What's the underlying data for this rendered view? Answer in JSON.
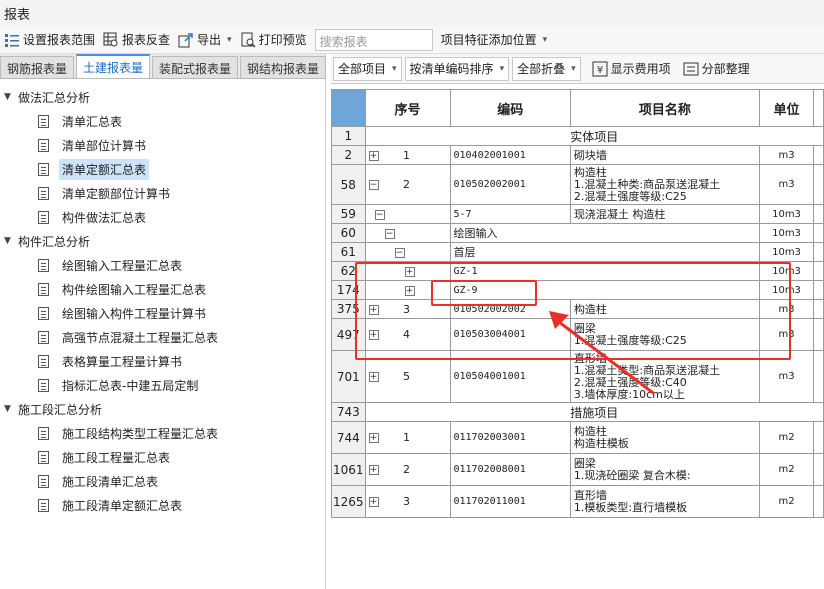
{
  "window": {
    "title": "报表"
  },
  "toolbar": {
    "set_range": "设置报表范围",
    "check": "报表反查",
    "export": "导出",
    "print_preview": "打印预览",
    "search_placeholder": "搜索报表",
    "feature_position": "项目特征添加位置"
  },
  "tabs": [
    "钢筋报表量",
    "土建报表量",
    "装配式报表量",
    "钢结构报表量"
  ],
  "tree": {
    "groups": [
      {
        "label": "做法汇总分析",
        "items": [
          "清单汇总表",
          "清单部位计算书",
          "清单定额汇总表",
          "清单定额部位计算书",
          "构件做法汇总表"
        ]
      },
      {
        "label": "构件汇总分析",
        "items": [
          "绘图输入工程量汇总表",
          "构件绘图输入工程量汇总表",
          "绘图输入构件工程量计算书",
          "高强节点混凝土工程量汇总表",
          "表格算量工程量计算书",
          "指标汇总表-中建五局定制"
        ]
      },
      {
        "label": "施工段汇总分析",
        "items": [
          "施工段结构类型工程量汇总表",
          "施工段工程量汇总表",
          "施工段清单汇总表",
          "施工段清单定额汇总表"
        ]
      }
    ],
    "selected": "清单定额汇总表"
  },
  "right_toolbar": {
    "all_items": "全部项目",
    "sort": "按清单编码排序",
    "collapse": "全部折叠",
    "show_fee": "显示费用项",
    "partition": "分部整理"
  },
  "table": {
    "headers": {
      "seq": "序号",
      "code": "编码",
      "name": "项目名称",
      "unit": "单位"
    },
    "section1": "实体项目",
    "section2": "措施项目",
    "rows": [
      {
        "rn": "1"
      },
      {
        "rn": "2",
        "seq": "1",
        "code": "010402001001",
        "name": "砌块墙",
        "unit": "m3"
      },
      {
        "rn": "58",
        "seq": "2",
        "code": "010502002001",
        "name": "构造柱\n1.混凝土种类:商品泵送混凝土\n2.混凝土强度等级:C25",
        "unit": "m3"
      },
      {
        "rn": "59",
        "code": "5-7",
        "name": "现浇混凝土 构造柱",
        "unit": "10m3"
      },
      {
        "rn": "60",
        "code": "绘图输入",
        "unit": "10m3"
      },
      {
        "rn": "61",
        "code": "首层",
        "unit": "10m3"
      },
      {
        "rn": "62",
        "code": "GZ-1",
        "unit": "10m3"
      },
      {
        "rn": "174",
        "code": "GZ-9",
        "unit": "10m3"
      },
      {
        "rn": "375",
        "seq": "3",
        "code": "010502002002",
        "name": "构造柱",
        "unit": "m3"
      },
      {
        "rn": "497",
        "seq": "4",
        "code": "010503004001",
        "name": "圈梁\n1.混凝土强度等级:C25",
        "unit": "m3"
      },
      {
        "rn": "701",
        "seq": "5",
        "code": "010504001001",
        "name": "直形墙\n1.混凝土类型:商品泵送混凝土\n2.混凝土强度等级:C40\n3.墙体厚度:10cm以上",
        "unit": "m3"
      },
      {
        "rn": "743"
      },
      {
        "rn": "744",
        "seq": "1",
        "code": "011702003001",
        "name": "构造柱\n构造柱模板",
        "unit": "m2"
      },
      {
        "rn": "1061",
        "seq": "2",
        "code": "011702008001",
        "name": "圈梁\n1.现浇砼圈梁 复合木模:",
        "unit": "m2"
      },
      {
        "rn": "1265",
        "seq": "3",
        "code": "011702011001",
        "name": "直形墙\n1.模板类型:直行墙模板",
        "unit": "m2"
      }
    ]
  },
  "colors": {
    "annotation": "#e8302a",
    "selected": "#cde3f7",
    "active_tab": "#1a6fc2",
    "header_corner": "#6fa6d8"
  }
}
